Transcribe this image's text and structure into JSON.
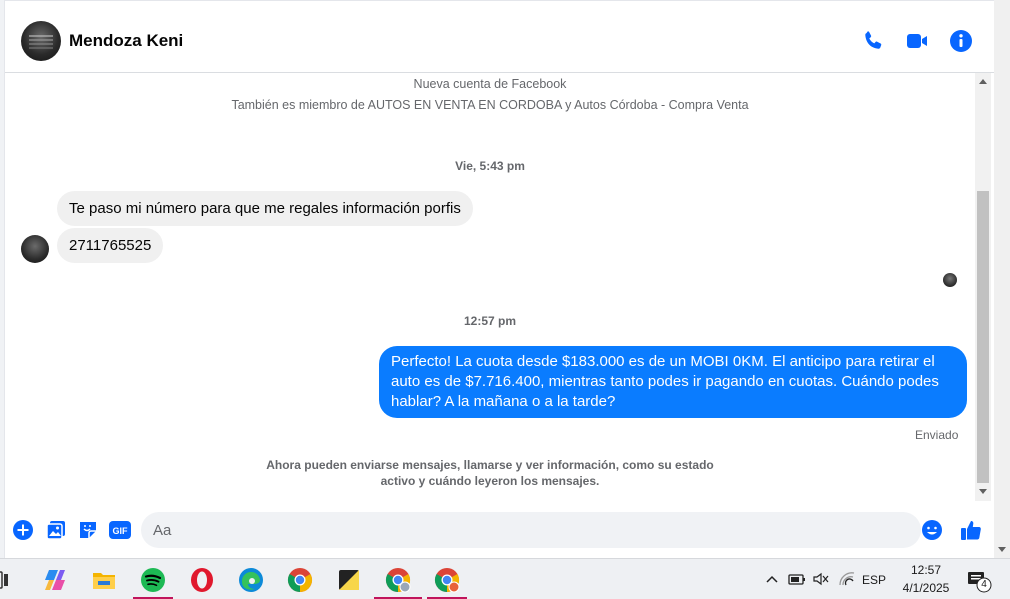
{
  "header": {
    "contact_name": "Mendoza Keni",
    "icons": [
      "phone-icon",
      "video-camera-icon",
      "info-icon"
    ]
  },
  "conversation": {
    "intro_line_1": "Nueva cuenta de Facebook",
    "intro_line_2": "También es miembro de AUTOS EN VENTA EN CORDOBA y Autos Córdoba - Compra Venta",
    "timestamp_1": "Vie, 5:43 pm",
    "incoming_1": "Te paso mi número para que me regales información porfis",
    "incoming_2": "2711765525",
    "timestamp_2": "12:57 pm",
    "outgoing_1_line_1": "Perfecto! La cuota desde $183.000 es de un MOBI 0KM. El anticipo para retirar el",
    "outgoing_1_line_2": "auto es de $7.716.400, mientras tanto podes ir pagando en cuotas. Cuándo podes",
    "outgoing_1_line_3": "hablar? A la mañana o a la tarde?",
    "outgoing_status": "Enviado",
    "footer_line_1": "Ahora pueden enviarse mensajes, llamarse y ver información, como su estado",
    "footer_line_2": "activo y cuándo leyeron los mensajes."
  },
  "composer": {
    "placeholder": "Aa",
    "icons": [
      "plus-icon",
      "photo-icon",
      "sticker-icon",
      "gif-icon",
      "emoji-icon",
      "thumbs-up-icon"
    ],
    "gif_label": "GIF"
  },
  "taskbar": {
    "apps": [
      "task-view-icon",
      "copilot-icon",
      "file-explorer-icon",
      "spotify-icon",
      "opera-icon",
      "edge-icon",
      "chrome-icon",
      "sticky-notes-icon",
      "chrome-profile-icon",
      "chrome-profile-2-icon"
    ],
    "language": "ESP",
    "time": "12:57",
    "date": "4/1/2025",
    "notification_count": "4"
  },
  "colors": {
    "accent": "#0a7cff",
    "incoming_bubble": "#f0f0f0",
    "header_icons": "#0866ff"
  }
}
